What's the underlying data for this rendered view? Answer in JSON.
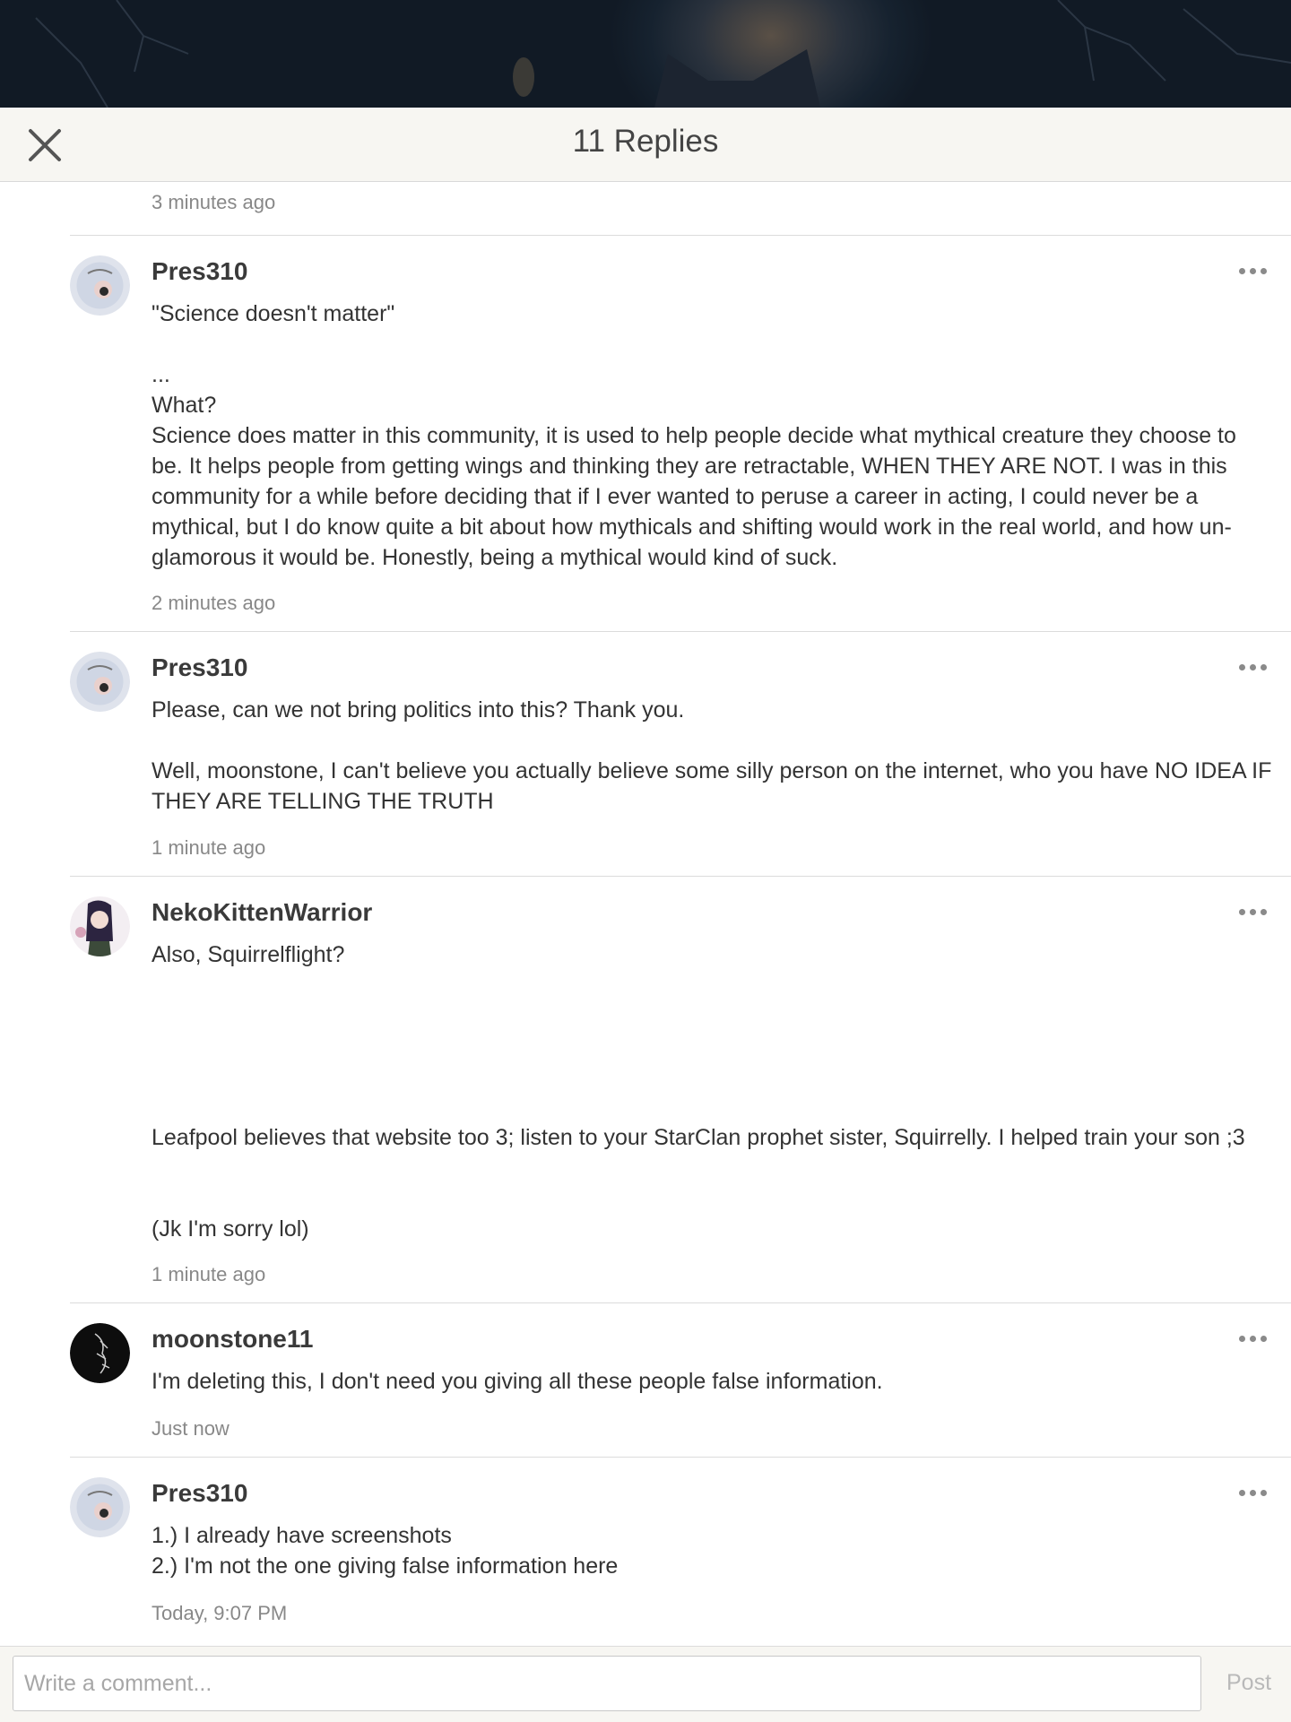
{
  "header": {
    "title": "11 Replies"
  },
  "first_timestamp": "3 minutes ago",
  "comments": [
    {
      "author": "Pres310",
      "avatar": "ouija-board-avatar",
      "body": "\"Science doesn't matter\"\n\n...\nWhat?\nScience does matter in this community, it is used to help people decide what mythical creature they choose to be. It helps people from getting wings and thinking they are retractable, WHEN THEY ARE NOT. I was in this community for a while before deciding that if I ever wanted to peruse a career in acting, I could never be a mythical, but I do know quite a bit about how mythicals and shifting would work in the real world, and how un-glamorous it would be. Honestly, being a mythical would kind of suck.",
      "time": "2 minutes ago"
    },
    {
      "author": "Pres310",
      "avatar": "ouija-board-avatar",
      "body": "Please, can we not bring politics into this? Thank you.\n\nWell, moonstone, I can't believe you actually believe some silly person on the internet, who you have NO IDEA IF THEY ARE TELLING THE TRUTH",
      "time": "1 minute ago"
    },
    {
      "author": "NekoKittenWarrior",
      "avatar": "anime-girl-avatar",
      "body": "Also, Squirrelflight?\n\n\n\n\n\nLeafpool believes that website too 3; listen to your StarClan prophet sister, Squirrelly. I helped train your son ;3\n\n\n(Jk I'm sorry lol)",
      "time": "1 minute ago"
    },
    {
      "author": "moonstone11",
      "avatar": "dark-sketch-avatar",
      "body": "I'm deleting this, I don't need you giving all these people false information.",
      "time": "Just now"
    },
    {
      "author": "Pres310",
      "avatar": "ouija-board-avatar",
      "body": "1.) I already have screenshots\n2.) I'm not the one giving false information here",
      "time": "Today, 9:07 PM"
    }
  ],
  "composer": {
    "placeholder": "Write a comment...",
    "post_label": "Post"
  }
}
